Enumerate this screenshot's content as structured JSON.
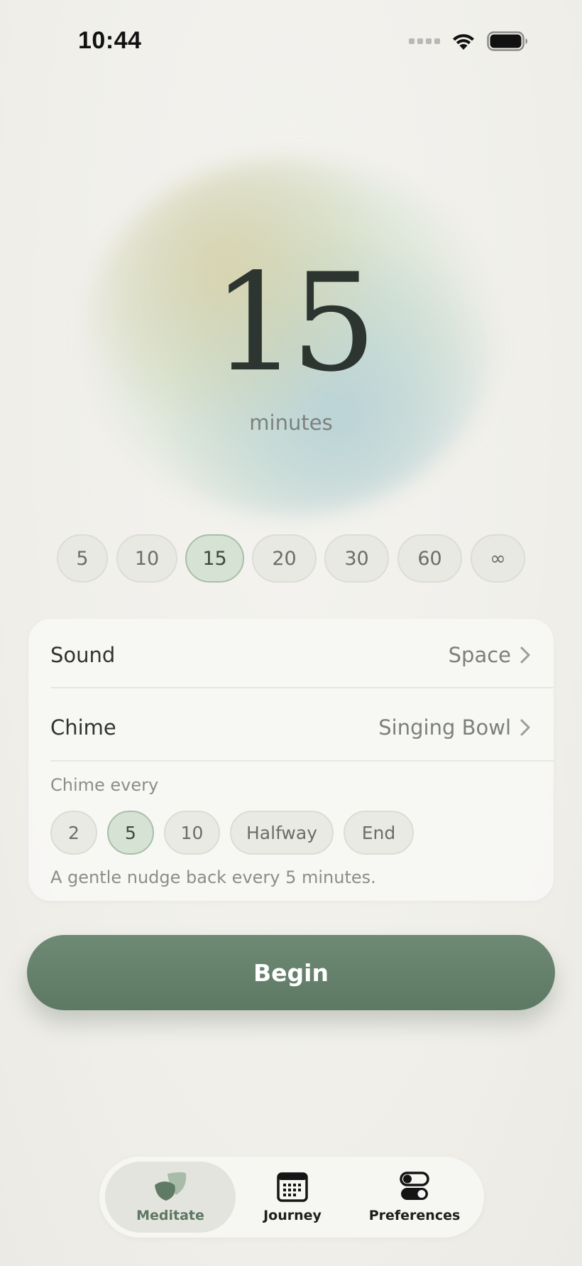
{
  "status_bar": {
    "time": "10:44",
    "signal_icon": "signal-dots-icon",
    "wifi_icon": "wifi-icon",
    "battery_icon": "battery-icon"
  },
  "timer": {
    "value": "15",
    "unit": "minutes"
  },
  "durations": {
    "options": [
      "5",
      "10",
      "15",
      "20",
      "30",
      "60",
      "∞"
    ],
    "selected": "15"
  },
  "settings": {
    "sound": {
      "label": "Sound",
      "value": "Space"
    },
    "chime": {
      "label": "Chime",
      "value": "Singing Bowl"
    },
    "chime_every": {
      "label": "Chime every",
      "options": [
        "2",
        "5",
        "10",
        "Halfway",
        "End"
      ],
      "selected": "5",
      "hint": "A gentle nudge back every 5 minutes."
    }
  },
  "begin_button": {
    "label": "Begin"
  },
  "tabs": [
    {
      "label": "Meditate",
      "icon": "leaf-icon",
      "active": true
    },
    {
      "label": "Journey",
      "icon": "calendar-icon",
      "active": false
    },
    {
      "label": "Preferences",
      "icon": "toggles-icon",
      "active": false
    }
  ],
  "colors": {
    "accent": "#5d7964",
    "selected_chip": "#d6e2d4",
    "background": "#f1f0eb"
  }
}
